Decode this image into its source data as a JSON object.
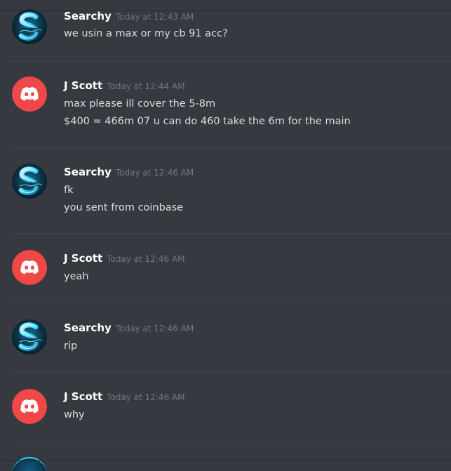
{
  "messages": [
    {
      "author": "Searchy",
      "timestamp": "Today at 12:43 AM",
      "avatar": "searchy-s-logo-icon",
      "lines": [
        "we usin a max or my cb 91 acc?"
      ]
    },
    {
      "author": "J Scott",
      "timestamp": "Today at 12:44 AM",
      "avatar": "discord-default-icon",
      "lines": [
        "max please ill cover the 5-8m",
        "$400 = 466m 07 u can do 460 take the 6m for the main"
      ]
    },
    {
      "author": "Searchy",
      "timestamp": "Today at 12:46 AM",
      "avatar": "searchy-s-logo-icon",
      "lines": [
        "fk",
        "you sent from coinbase"
      ]
    },
    {
      "author": "J Scott",
      "timestamp": "Today at 12:46 AM",
      "avatar": "discord-default-icon",
      "lines": [
        "yeah"
      ]
    },
    {
      "author": "Searchy",
      "timestamp": "Today at 12:46 AM",
      "avatar": "searchy-s-logo-icon",
      "lines": [
        "rip"
      ]
    },
    {
      "author": "J Scott",
      "timestamp": "Today at 12:46 AM",
      "avatar": "discord-default-icon",
      "lines": [
        "why"
      ]
    }
  ],
  "colors": {
    "background": "#36393f",
    "username": "#ffffff",
    "timestamp": "#72767d",
    "message_text": "#dcddde",
    "divider": "#40444b",
    "discord_red": "#f04747",
    "searchy_cyan": "#2fd5ff"
  }
}
